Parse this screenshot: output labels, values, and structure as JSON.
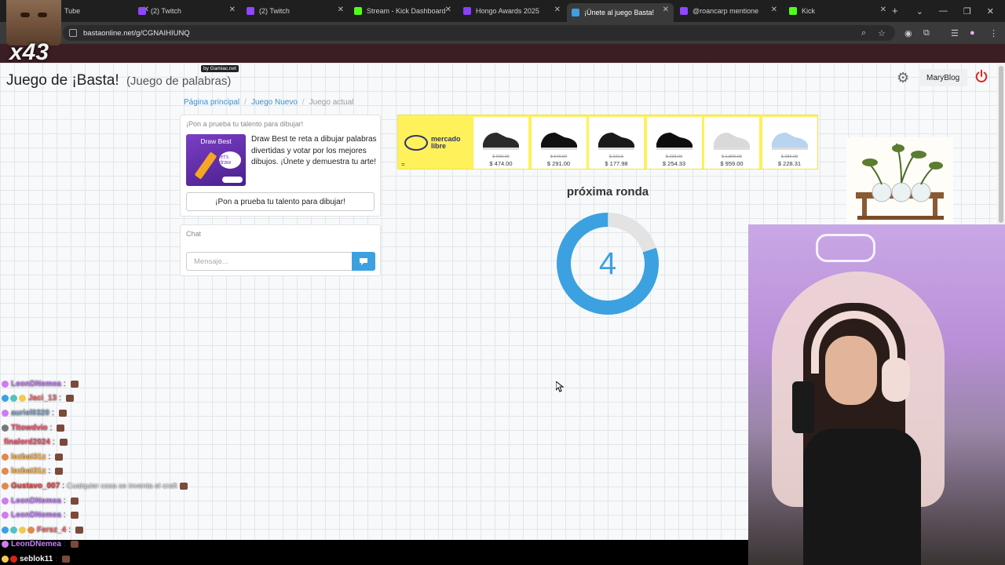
{
  "browser": {
    "tabs": [
      {
        "label": "Tube",
        "icon": "youtube-icon",
        "color": "#ff0000"
      },
      {
        "label": "(2) Twitch",
        "icon": "twitch-icon",
        "color": "#9146ff"
      },
      {
        "label": "(2) Twitch",
        "icon": "twitch-icon",
        "color": "#9146ff"
      },
      {
        "label": "Stream - Kick Dashboard",
        "icon": "kick-icon",
        "color": "#53fc18"
      },
      {
        "label": "Hongo Awards 2025",
        "icon": "hongo-icon",
        "color": "#8a3ffc"
      },
      {
        "label": "¡Únete al juego Basta!",
        "icon": "globe-icon",
        "color": "#3ba1e0"
      },
      {
        "label": "@roancarp mentione",
        "icon": "bell-icon",
        "color": "#9146ff"
      },
      {
        "label": "Kick",
        "icon": "kick-icon",
        "color": "#53fc18"
      }
    ],
    "url": "bastaonline.net/g/CGNAIHIUNQ"
  },
  "header": {
    "title": "Juego de ¡Basta!",
    "subtitle": "(Juego de palabras)",
    "badge": "by Gamiac.net",
    "username": "MaryBlog"
  },
  "breadcrumb": {
    "home": "Página principal",
    "new_game": "Juego Nuevo",
    "current": "Juego actual"
  },
  "draw_promo": {
    "heading": "¡Pon a prueba tu talento para dibujar!",
    "image_title": "Draw Best",
    "image_bubble": "let's draw",
    "description": "Draw Best te reta a dibujar palabras divertidas y votar por los mejores dibujos. ¡Únete y demuestra tu arte!",
    "button": "¡Pon a prueba tu talento para dibujar!"
  },
  "chat": {
    "heading": "Chat",
    "placeholder": "Mensaje..."
  },
  "ad": {
    "brand_line1": "mercado",
    "brand_line2": "libre",
    "equals": "=",
    "items": [
      {
        "old": "$ 600.00",
        "price": "$ 474.00",
        "color": "#2b2b2b"
      },
      {
        "old": "$ 549.00",
        "price": "$ 291.00",
        "color": "#111111"
      },
      {
        "old": "$ 221.5",
        "price": "$ 177.98",
        "color": "#1a1a1a"
      },
      {
        "old": "$ 238.00",
        "price": "$ 254.33",
        "color": "#0e0e0e"
      },
      {
        "old": "$ 1,890.00",
        "price": "$ 959.00",
        "color": "#d9d9d9"
      },
      {
        "old": "$ 286.00",
        "price": "$ 228.31",
        "color": "#b9d4ee"
      }
    ]
  },
  "round": {
    "title": "próxima ronda",
    "countdown": "4",
    "progress": 0.8,
    "accent": "#3ba1e0",
    "track": "#e3e3e3"
  },
  "stream_overlay": {
    "multiplier": "x43",
    "chat": [
      {
        "user": "LeonDNemea",
        "color": "#c77dff",
        "msg": ""
      },
      {
        "user": "Jaci_13",
        "color": "#ff6b6b",
        "msg": ""
      },
      {
        "user": "auriel0320",
        "color": "#8aa4c8",
        "msg": ""
      },
      {
        "user": "Tltowdvio",
        "color": "#ff4d6d",
        "msg": ""
      },
      {
        "user": "finalord2024",
        "color": "#ff4d6d",
        "msg": ""
      },
      {
        "user": "lezbat31z",
        "color": "#ffb347",
        "msg": ""
      },
      {
        "user": "lezbat31z",
        "color": "#ffb347",
        "msg": ""
      },
      {
        "user": "Gustavo_007",
        "color": "#ff3b3b",
        "msg": "Cualquier cosa se inventa el craft"
      },
      {
        "user": "LeonDNemea",
        "color": "#c77dff",
        "msg": ""
      },
      {
        "user": "LeonDNemea",
        "color": "#c77dff",
        "msg": ""
      },
      {
        "user": "Fersz_4",
        "color": "#ff6b6b",
        "msg": ""
      },
      {
        "user": "LeonDNemea",
        "color": "#c77dff",
        "msg": ""
      },
      {
        "user": "seblok11",
        "color": "#f3f3f3",
        "msg": ""
      }
    ]
  }
}
